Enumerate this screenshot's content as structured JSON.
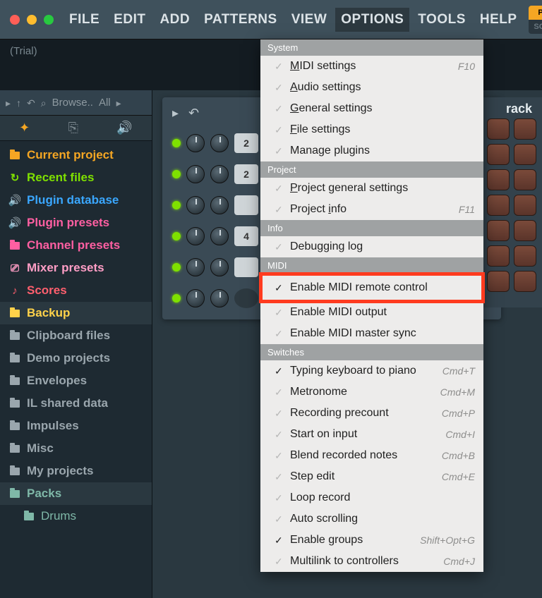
{
  "menubar": [
    "FILE",
    "EDIT",
    "ADD",
    "PATTERNS",
    "VIEW",
    "OPTIONS",
    "TOOLS",
    "HELP"
  ],
  "menubar_active_index": 5,
  "pat_song": {
    "pat": "PAT",
    "song": "SONG"
  },
  "infostrip": "(Trial)",
  "browser": {
    "toolbar_label": "Browse..",
    "toolbar_filter": "All",
    "items": [
      {
        "label": "Current project",
        "color": "#f5a623",
        "icon": "folder"
      },
      {
        "label": "Recent files",
        "color": "#7fe100",
        "icon": "refresh"
      },
      {
        "label": "Plugin database",
        "color": "#3aa7ff",
        "icon": "speaker"
      },
      {
        "label": "Plugin presets",
        "color": "#ff5fa2",
        "icon": "speaker"
      },
      {
        "label": "Channel presets",
        "color": "#ff5fa2",
        "icon": "folder"
      },
      {
        "label": "Mixer presets",
        "color": "#ff9ec6",
        "icon": "sliders"
      },
      {
        "label": "Scores",
        "color": "#ff5f6e",
        "icon": "note"
      },
      {
        "label": "Backup",
        "color": "#ffd24a",
        "icon": "folder",
        "group": true
      },
      {
        "label": "Clipboard files",
        "color": "#9aa6ad",
        "icon": "folder"
      },
      {
        "label": "Demo projects",
        "color": "#9aa6ad",
        "icon": "folder"
      },
      {
        "label": "Envelopes",
        "color": "#9aa6ad",
        "icon": "folder"
      },
      {
        "label": "IL shared data",
        "color": "#9aa6ad",
        "icon": "folder"
      },
      {
        "label": "Impulses",
        "color": "#9aa6ad",
        "icon": "folder"
      },
      {
        "label": "Misc",
        "color": "#9aa6ad",
        "icon": "folder"
      },
      {
        "label": "My projects",
        "color": "#9aa6ad",
        "icon": "folder"
      },
      {
        "label": "Packs",
        "color": "#7fb8a8",
        "icon": "folder",
        "group": true
      },
      {
        "label": "Drums",
        "color": "#7fb8a8",
        "icon": "folder",
        "sub": true
      }
    ]
  },
  "channels": {
    "buttons": [
      "2",
      "2",
      "",
      "4",
      "",
      ""
    ]
  },
  "rack_title": "rack",
  "options_menu": {
    "sections": [
      {
        "title": "System",
        "items": [
          {
            "label": "MIDI settings",
            "ul": 0,
            "accel": "F10"
          },
          {
            "label": "Audio settings",
            "ul": 0
          },
          {
            "label": "General settings",
            "ul": 0
          },
          {
            "label": "File settings",
            "ul": 0
          },
          {
            "label": "Manage plugins"
          }
        ]
      },
      {
        "title": "Project",
        "items": [
          {
            "label": "Project general settings",
            "ul": 0
          },
          {
            "label": "Project info",
            "ul": 8,
            "accel": "F11"
          }
        ]
      },
      {
        "title": "Info",
        "items": [
          {
            "label": "Debugging log"
          }
        ]
      },
      {
        "title": "MIDI",
        "items": [
          {
            "label": "Enable MIDI remote control",
            "checked": true,
            "highlight": true
          },
          {
            "label": "Enable MIDI output"
          },
          {
            "label": "Enable MIDI master sync"
          }
        ]
      },
      {
        "title": "Switches",
        "items": [
          {
            "label": "Typing keyboard to piano",
            "checked": true,
            "accel": "Cmd+T"
          },
          {
            "label": "Metronome",
            "accel": "Cmd+M"
          },
          {
            "label": "Recording precount",
            "accel": "Cmd+P"
          },
          {
            "label": "Start on input",
            "accel": "Cmd+I"
          },
          {
            "label": "Blend recorded notes",
            "accel": "Cmd+B"
          },
          {
            "label": "Step edit",
            "accel": "Cmd+E"
          },
          {
            "label": "Loop record"
          },
          {
            "label": "Auto scrolling"
          },
          {
            "label": "Enable groups",
            "checked": true,
            "accel": "Shift+Opt+G"
          },
          {
            "label": "Multilink to controllers",
            "accel": "Cmd+J"
          }
        ]
      }
    ]
  }
}
